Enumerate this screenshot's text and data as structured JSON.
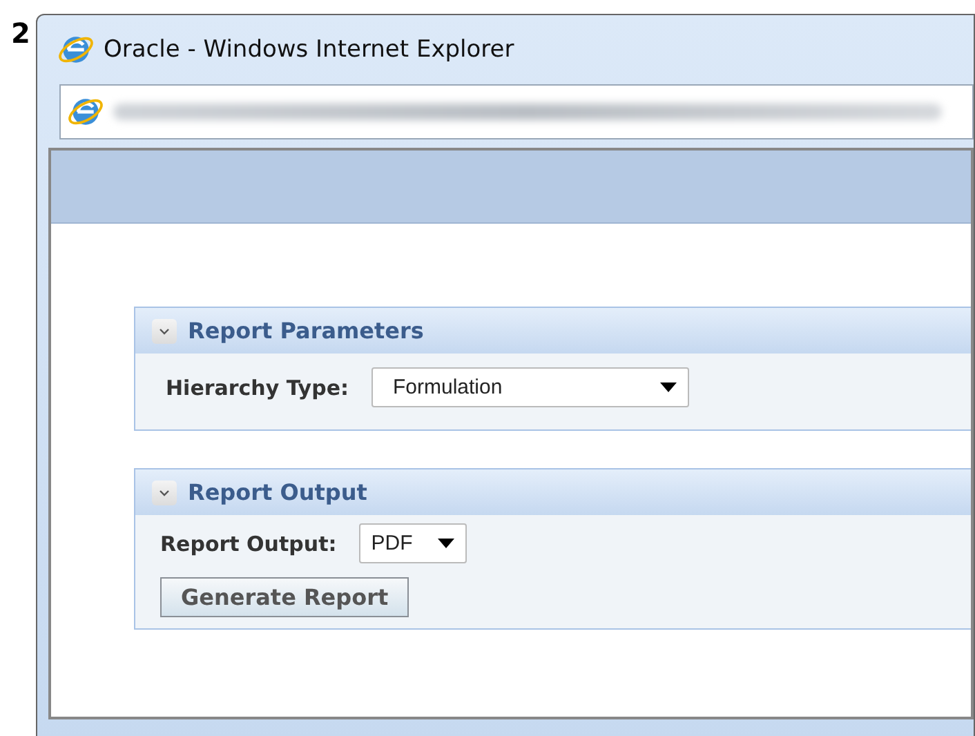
{
  "step_number": "2",
  "window": {
    "title": "Oracle - Windows Internet Explorer"
  },
  "sections": [
    {
      "title": "Report Parameters",
      "expanded": true,
      "fields": [
        {
          "label": "Hierarchy Type:",
          "value": "Formulation",
          "kind": "dropdown"
        }
      ]
    },
    {
      "title": "Report Output",
      "expanded": true,
      "fields": [
        {
          "label": "Report Output:",
          "value": "PDF",
          "kind": "dropdown"
        }
      ],
      "buttons": [
        "Generate Report"
      ]
    }
  ]
}
